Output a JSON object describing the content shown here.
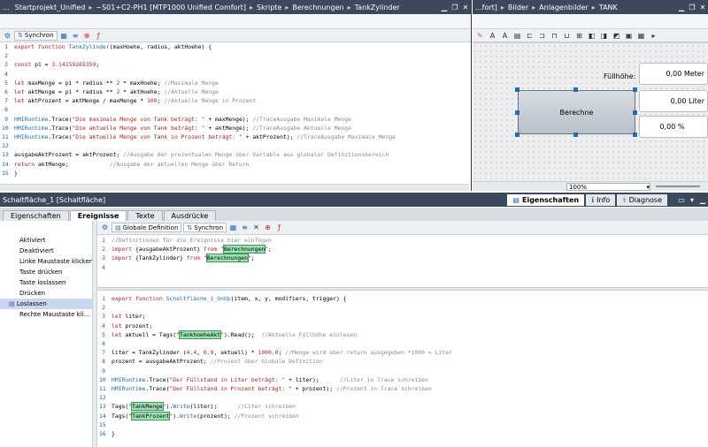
{
  "left_title": {
    "prefix": "...",
    "crumbs": [
      "Startprojekt_Unified",
      "~S01+C2-PH1 [MTP1000 Unified Comfort]",
      "Skripte",
      "Berechnungen",
      "TankZylinder"
    ]
  },
  "right_title": {
    "crumbs": [
      "...fort]",
      "Bilder",
      "Anlagenbilder",
      "TANK"
    ]
  },
  "editor_toolbar": {
    "sync_label": "Synchron"
  },
  "top_code": [
    {
      "n": "1",
      "p": [
        [
          "kw",
          "export function "
        ],
        [
          "fn",
          "TankZylinder"
        ],
        [
          "",
          "(maxHoehe, radius, aktHoehe) {"
        ]
      ]
    },
    {
      "n": "2",
      "p": []
    },
    {
      "n": "3",
      "p": [
        [
          "kw",
          "const "
        ],
        [
          "",
          "pi = "
        ],
        [
          "str",
          "3.14159265359"
        ],
        [
          "",
          ";"
        ]
      ]
    },
    {
      "n": "4",
      "p": []
    },
    {
      "n": "5",
      "p": [
        [
          "kw",
          "let "
        ],
        [
          "",
          "maxMenge = pi * radius ** "
        ],
        [
          "str",
          "2"
        ],
        [
          "",
          " * maxHoehe; "
        ],
        [
          "cm",
          "//Maximale Menge"
        ]
      ]
    },
    {
      "n": "6",
      "p": [
        [
          "kw",
          "let "
        ],
        [
          "",
          "aktMenge = pi * radius ** "
        ],
        [
          "str",
          "2"
        ],
        [
          "",
          " * aktHoehe; "
        ],
        [
          "cm",
          "//Aktuelle Menge"
        ]
      ]
    },
    {
      "n": "7",
      "p": [
        [
          "kw",
          "let "
        ],
        [
          "",
          "aktProzent = aktMenge / maxMenge * "
        ],
        [
          "str",
          "100"
        ],
        [
          "",
          "; "
        ],
        [
          "cm",
          "//Aktuelle Menge in Prozent"
        ]
      ]
    },
    {
      "n": "8",
      "p": []
    },
    {
      "n": "9",
      "p": [
        [
          "fn",
          "HMIRuntime"
        ],
        [
          "",
          ".Trace("
        ],
        [
          "str",
          "\"Die maximale Menge von Tank beträgt: \""
        ],
        [
          "",
          " + maxMenge); "
        ],
        [
          "cm",
          "//TraceAusgabe Maximale Menge"
        ]
      ]
    },
    {
      "n": "10",
      "p": [
        [
          "fn",
          "HMIRuntime"
        ],
        [
          "",
          ".Trace("
        ],
        [
          "str",
          "\"Die aktuelle Menge von Tank beträgt: \""
        ],
        [
          "",
          " + aktMenge); "
        ],
        [
          "cm",
          "//TraceAusgabe Aktuelle Menge"
        ]
      ]
    },
    {
      "n": "11",
      "p": [
        [
          "fn",
          "HMIRuntime"
        ],
        [
          "",
          ".Trace("
        ],
        [
          "str",
          "\"Die aktuelle Menge von Tank in Prozent beträgt: \""
        ],
        [
          "",
          " + aktProzent); "
        ],
        [
          "cm",
          "//TraceAusgabe Maximale Menge"
        ]
      ]
    },
    {
      "n": "12",
      "p": []
    },
    {
      "n": "13",
      "p": [
        [
          "",
          "ausgabeAktProzent = aktProzent; "
        ],
        [
          "cm",
          "//Ausgabe der prozentualen Menge über Variable aus globaler Definitionsbereich"
        ]
      ]
    },
    {
      "n": "14",
      "p": [
        [
          "kw",
          "return "
        ],
        [
          "",
          "aktMenge;            "
        ],
        [
          "cm",
          "//Ausgabe der aktuellen Menge über Return"
        ]
      ]
    },
    {
      "n": "15",
      "p": [
        [
          "",
          "}"
        ]
      ]
    }
  ],
  "screen": {
    "label_fuellhoehe": "Füllhöhe:",
    "field1": "0,00 Meter",
    "field2": "0,00 Liter",
    "field3": "0,00 %",
    "button_label": "Berechne",
    "zoom": "100%"
  },
  "inspector": {
    "title": "Schaltfläche_1 [Schaltfläche]",
    "tabs_right": [
      "Eigenschaften",
      "Info",
      "Diagnose"
    ],
    "tabs_left": [
      "Eigenschaften",
      "Ereignisse",
      "Texte",
      "Animationen",
      "Ausdrücke"
    ]
  },
  "events": [
    "Aktiviert",
    "Deaktiviert",
    "Linke Maustaste klicken",
    "Taste drücken",
    "Taste loslassen",
    "Drücken",
    "Loslassen",
    "Rechte Maustaste kli..."
  ],
  "events_active": "Loslassen",
  "lower_toolbar": {
    "global_label": "Globale Definition",
    "sync_label": "Synchron"
  },
  "global_code": [
    {
      "n": "1",
      "p": [
        [
          "cm",
          "//Definitionen für die Ereignisse hier einfügen"
        ]
      ]
    },
    {
      "n": "2",
      "p": [
        [
          "kw",
          "import "
        ],
        [
          "",
          "{ausgabeAktProzent} "
        ],
        [
          "kw",
          "from "
        ],
        [
          "str",
          "\""
        ],
        [
          "hl",
          "Berechnungen"
        ],
        [
          "str",
          "\""
        ],
        [
          "",
          ";"
        ]
      ]
    },
    {
      "n": "3",
      "p": [
        [
          "kw",
          "import "
        ],
        [
          "",
          "{TankZylinder} "
        ],
        [
          "kw",
          "from "
        ],
        [
          "str",
          "\""
        ],
        [
          "hl",
          "Berechnungen"
        ],
        [
          "str",
          "\""
        ],
        [
          "",
          ";"
        ]
      ]
    },
    {
      "n": "4",
      "p": []
    }
  ],
  "event_code": [
    {
      "n": "1",
      "p": [
        [
          "kw",
          "export function "
        ],
        [
          "fn",
          "Schaltfläche_1_OnUp"
        ],
        [
          "",
          "(item, x, y, modifiers, trigger) {"
        ]
      ]
    },
    {
      "n": "2",
      "p": []
    },
    {
      "n": "3",
      "p": [
        [
          "kw",
          "let "
        ],
        [
          "",
          "liter;"
        ]
      ]
    },
    {
      "n": "4",
      "p": [
        [
          "kw",
          "let "
        ],
        [
          "",
          "prozent;"
        ]
      ]
    },
    {
      "n": "5",
      "p": [
        [
          "kw",
          "let "
        ],
        [
          "",
          "aktuell = Tags("
        ],
        [
          "str",
          "\""
        ],
        [
          "hl",
          "TankhoeheAkt"
        ],
        [
          "str",
          "\""
        ],
        [
          "",
          ").Read();  "
        ],
        [
          "cm",
          "//Aktuelle Füllhöhe einlesen"
        ]
      ]
    },
    {
      "n": "6",
      "p": []
    },
    {
      "n": "7",
      "p": [
        [
          "",
          "liter = TankZylinder ("
        ],
        [
          "str",
          "4.4"
        ],
        [
          "",
          ", "
        ],
        [
          "str",
          "0.9"
        ],
        [
          "",
          ", aktuell) * "
        ],
        [
          "str",
          "1000.0"
        ],
        [
          "",
          "; "
        ],
        [
          "cm",
          "//Menge wird über return ausgegeben *1000 = Liter"
        ]
      ]
    },
    {
      "n": "8",
      "p": [
        [
          "",
          "prozent = ausgabeAktProzent; "
        ],
        [
          "cm",
          "//Prozent über Globale Definition"
        ]
      ]
    },
    {
      "n": "9",
      "p": []
    },
    {
      "n": "10",
      "p": [
        [
          "fn",
          "HMIRuntime"
        ],
        [
          "",
          ".Trace("
        ],
        [
          "str",
          "\"Der Füllstand in Liter beträgt: \""
        ],
        [
          "",
          " + liter);      "
        ],
        [
          "cm",
          "//Liter in Trace schreiben"
        ]
      ]
    },
    {
      "n": "11",
      "p": [
        [
          "fn",
          "HMIRuntime"
        ],
        [
          "",
          ".Trace("
        ],
        [
          "str",
          "\"Der Füllstand in Prozent beträgt: \""
        ],
        [
          "",
          " + prozent); "
        ],
        [
          "cm",
          "//Prozent in Trace schreiben"
        ]
      ]
    },
    {
      "n": "12",
      "p": []
    },
    {
      "n": "13",
      "p": [
        [
          "",
          "Tags("
        ],
        [
          "str",
          "\""
        ],
        [
          "hl",
          "TankMenge"
        ],
        [
          "str",
          "\""
        ],
        [
          "",
          ")."
        ],
        [
          "fn",
          "Write"
        ],
        [
          "",
          "(liter);      "
        ],
        [
          "cm",
          "//Liter schreiben"
        ]
      ]
    },
    {
      "n": "14",
      "p": [
        [
          "",
          "Tags("
        ],
        [
          "str",
          "\""
        ],
        [
          "hl",
          "TankProzent"
        ],
        [
          "str",
          "\""
        ],
        [
          "",
          ")."
        ],
        [
          "fn",
          "Write"
        ],
        [
          "",
          "(prozent); "
        ],
        [
          "cm",
          "//Prozent schreiben"
        ]
      ]
    },
    {
      "n": "15",
      "p": []
    },
    {
      "n": "16",
      "p": [
        [
          "",
          "}"
        ]
      ]
    }
  ]
}
